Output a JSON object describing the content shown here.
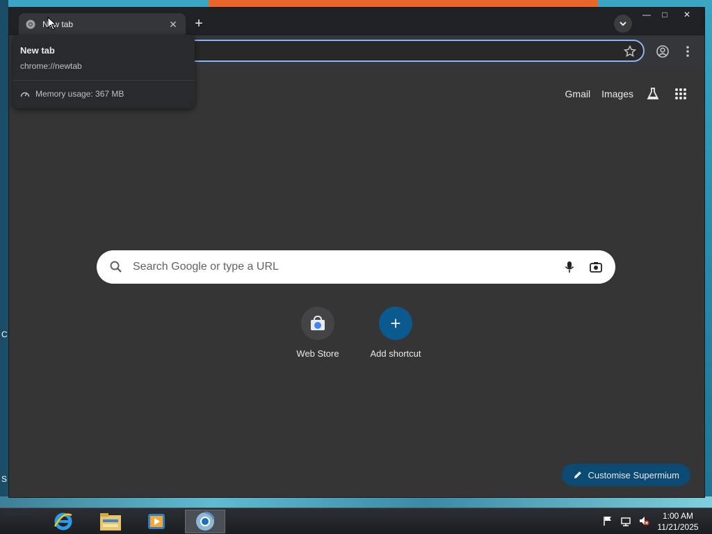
{
  "desktop": {
    "edge_text_1": "C",
    "edge_text_2": "S"
  },
  "window": {
    "tab": {
      "title": "New tab",
      "close_icon": "close-icon",
      "favicon": "chrome-icon"
    },
    "new_tab_symbol": "+",
    "controls": {
      "minimize": "—",
      "maximize": "□",
      "close": "✕"
    }
  },
  "hover_card": {
    "title": "New tab",
    "url": "chrome://newtab",
    "memory": "Memory usage: 367 MB"
  },
  "page": {
    "top_links": [
      "Gmail",
      "Images"
    ],
    "search": {
      "placeholder": "Search Google or type a URL"
    },
    "shortcuts": [
      {
        "label": "Web Store",
        "icon": "webstore-icon"
      },
      {
        "label": "Add shortcut",
        "icon": "plus-icon",
        "symbol": "+"
      }
    ],
    "customise_label": "Customise Supermium"
  },
  "taskbar": {
    "items": [
      "internet-explorer-icon",
      "file-explorer-icon",
      "media-player-icon",
      "chrome-icon"
    ],
    "clock_time": "1:00 AM",
    "clock_date": "11/21/2025"
  },
  "colors": {
    "accent": "#8ab4f8",
    "customise_bg": "#0b4a73",
    "add_shortcut_bg": "#0b5a8f",
    "page_bg": "#353535"
  }
}
